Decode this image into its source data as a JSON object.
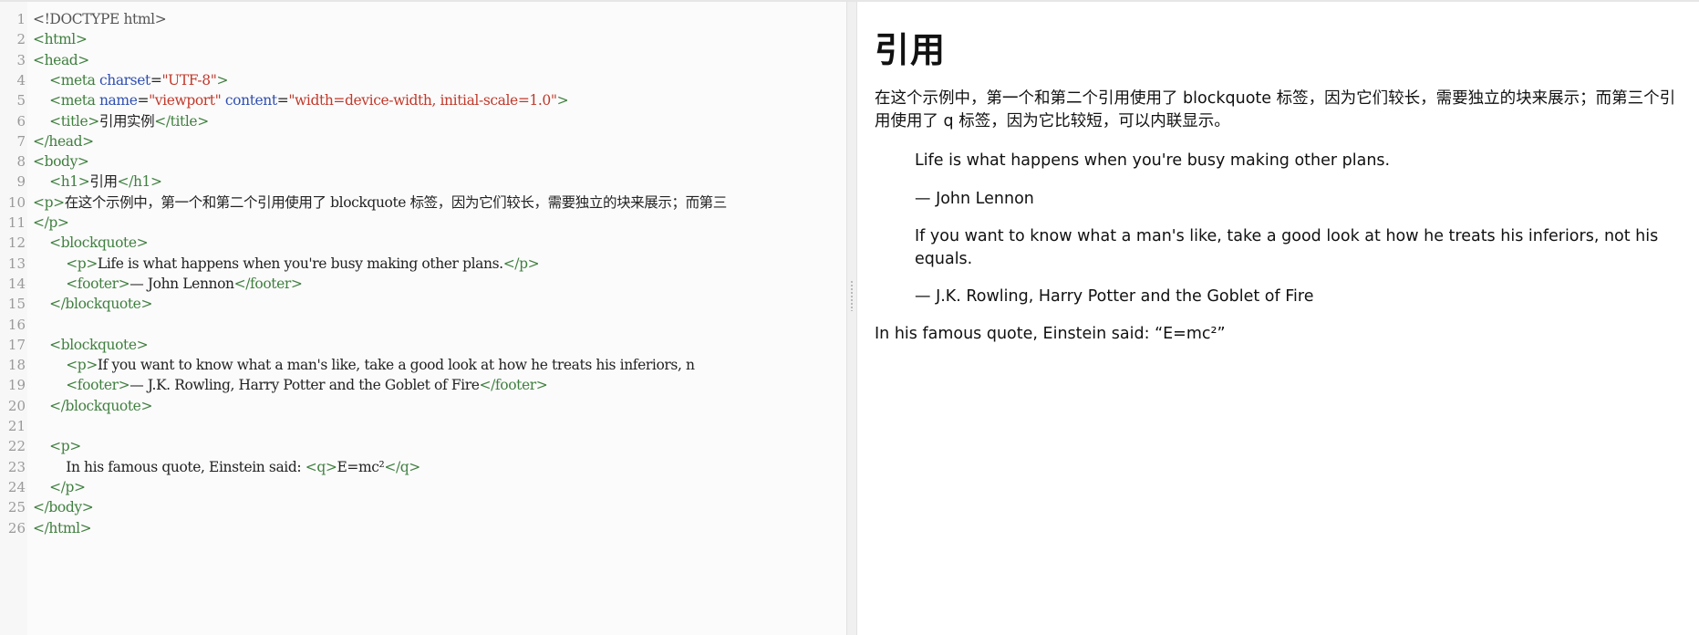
{
  "editor": {
    "lines": [
      {
        "n": "1",
        "segs": [
          [
            "dt",
            "<!DOCTYPE html>"
          ]
        ]
      },
      {
        "n": "2",
        "segs": [
          [
            "t",
            "<html>"
          ]
        ]
      },
      {
        "n": "3",
        "segs": [
          [
            "t",
            "<head>"
          ]
        ]
      },
      {
        "n": "4",
        "segs": [
          [
            "tx",
            "    "
          ],
          [
            "t",
            "<meta "
          ],
          [
            "a",
            "charset"
          ],
          [
            "tx",
            "="
          ],
          [
            "v",
            "\"UTF-8\""
          ],
          [
            "t",
            ">"
          ]
        ]
      },
      {
        "n": "5",
        "segs": [
          [
            "tx",
            "    "
          ],
          [
            "t",
            "<meta "
          ],
          [
            "a",
            "name"
          ],
          [
            "tx",
            "="
          ],
          [
            "v",
            "\"viewport\""
          ],
          [
            "tx",
            " "
          ],
          [
            "a",
            "content"
          ],
          [
            "tx",
            "="
          ],
          [
            "v",
            "\"width=device-width, initial-scale=1.0\""
          ],
          [
            "t",
            ">"
          ]
        ]
      },
      {
        "n": "6",
        "segs": [
          [
            "tx",
            "    "
          ],
          [
            "t",
            "<title>"
          ],
          [
            "tx",
            "引用实例"
          ],
          [
            "t",
            "</title>"
          ]
        ]
      },
      {
        "n": "7",
        "segs": [
          [
            "t",
            "</head>"
          ]
        ]
      },
      {
        "n": "8",
        "segs": [
          [
            "t",
            "<body>"
          ]
        ]
      },
      {
        "n": "9",
        "segs": [
          [
            "tx",
            "    "
          ],
          [
            "t",
            "<h1>"
          ],
          [
            "tx",
            "引用"
          ],
          [
            "t",
            "</h1>"
          ]
        ]
      },
      {
        "n": "10",
        "segs": [
          [
            "t",
            "<p>"
          ],
          [
            "tx",
            "在这个示例中，第一个和第二个引用使用了 blockquote 标签，因为它们较长，需要独立的块来展示；而第三"
          ]
        ]
      },
      {
        "n": "11",
        "segs": [
          [
            "t",
            "</p>"
          ]
        ]
      },
      {
        "n": "12",
        "segs": [
          [
            "tx",
            "    "
          ],
          [
            "t",
            "<blockquote>"
          ]
        ]
      },
      {
        "n": "13",
        "segs": [
          [
            "tx",
            "        "
          ],
          [
            "t",
            "<p>"
          ],
          [
            "tx",
            "Life is what happens when you're busy making other plans."
          ],
          [
            "t",
            "</p>"
          ]
        ]
      },
      {
        "n": "14",
        "segs": [
          [
            "tx",
            "        "
          ],
          [
            "t",
            "<footer>"
          ],
          [
            "tx",
            "— John Lennon"
          ],
          [
            "t",
            "</footer>"
          ]
        ]
      },
      {
        "n": "15",
        "segs": [
          [
            "tx",
            "    "
          ],
          [
            "t",
            "</blockquote>"
          ]
        ]
      },
      {
        "n": "16",
        "segs": []
      },
      {
        "n": "17",
        "segs": [
          [
            "tx",
            "    "
          ],
          [
            "t",
            "<blockquote>"
          ]
        ]
      },
      {
        "n": "18",
        "segs": [
          [
            "tx",
            "        "
          ],
          [
            "t",
            "<p>"
          ],
          [
            "tx",
            "If you want to know what a man's like, take a good look at how he treats his inferiors, n"
          ]
        ]
      },
      {
        "n": "19",
        "segs": [
          [
            "tx",
            "        "
          ],
          [
            "t",
            "<footer>"
          ],
          [
            "tx",
            "— J.K. Rowling, Harry Potter and the Goblet of Fire"
          ],
          [
            "t",
            "</footer>"
          ]
        ]
      },
      {
        "n": "20",
        "segs": [
          [
            "tx",
            "    "
          ],
          [
            "t",
            "</blockquote>"
          ]
        ]
      },
      {
        "n": "21",
        "segs": []
      },
      {
        "n": "22",
        "segs": [
          [
            "tx",
            "    "
          ],
          [
            "t",
            "<p>"
          ]
        ]
      },
      {
        "n": "23",
        "segs": [
          [
            "tx",
            "        In his famous quote, Einstein said: "
          ],
          [
            "t",
            "<q>"
          ],
          [
            "tx",
            "E=mc²"
          ],
          [
            "t",
            "</q>"
          ]
        ]
      },
      {
        "n": "24",
        "segs": [
          [
            "tx",
            "    "
          ],
          [
            "t",
            "</p>"
          ]
        ]
      },
      {
        "n": "25",
        "segs": [
          [
            "t",
            "</body>"
          ]
        ]
      },
      {
        "n": "26",
        "segs": [
          [
            "t",
            "</html>"
          ]
        ]
      }
    ]
  },
  "preview": {
    "heading": "引用",
    "intro": "在这个示例中，第一个和第二个引用使用了 blockquote 标签，因为它们较长，需要独立的块来展示；而第三个引用使用了 q 标签，因为它比较短，可以内联显示。",
    "quote1": "Life is what happens when you're busy making other plans.",
    "quote1_footer": "— John Lennon",
    "quote2": "If you want to know what a man's like, take a good look at how he treats his inferiors, not his equals.",
    "quote2_footer": "— J.K. Rowling, Harry Potter and the Goblet of Fire",
    "einstein_prefix": "In his famous quote, Einstein said: ",
    "einstein_quote": "“E=mc²”"
  }
}
